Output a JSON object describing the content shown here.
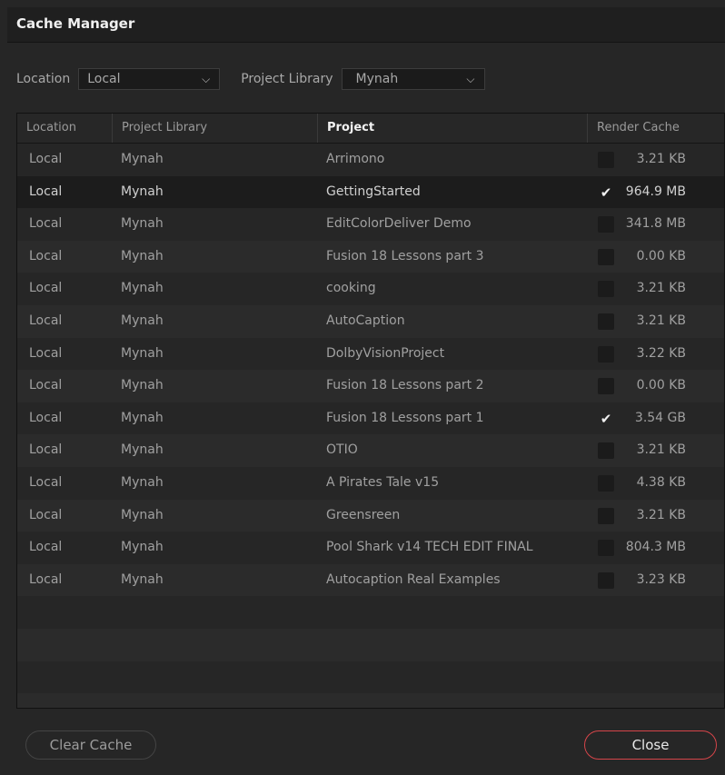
{
  "window": {
    "title": "Cache Manager"
  },
  "filters": {
    "location_label": "Location",
    "location_value": "Local",
    "library_label": "Project Library",
    "library_value": "Mynah"
  },
  "table": {
    "columns": [
      "Location",
      "Project Library",
      "Project",
      "Render Cache"
    ],
    "active_column": "Project",
    "rows": [
      {
        "location": "Local",
        "library": "Mynah",
        "project": "Arrimono",
        "checked": false,
        "size": "3.21 KB"
      },
      {
        "location": "Local",
        "library": "Mynah",
        "project": "GettingStarted",
        "checked": true,
        "size": "964.9 MB",
        "selected": true
      },
      {
        "location": "Local",
        "library": "Mynah",
        "project": "EditColorDeliver Demo",
        "checked": false,
        "size": "341.8 MB"
      },
      {
        "location": "Local",
        "library": "Mynah",
        "project": "Fusion 18 Lessons part 3",
        "checked": false,
        "size": "0.00 KB"
      },
      {
        "location": "Local",
        "library": "Mynah",
        "project": "cooking",
        "checked": false,
        "size": "3.21 KB"
      },
      {
        "location": "Local",
        "library": "Mynah",
        "project": "AutoCaption",
        "checked": false,
        "size": "3.21 KB"
      },
      {
        "location": "Local",
        "library": "Mynah",
        "project": "DolbyVisionProject",
        "checked": false,
        "size": "3.22 KB"
      },
      {
        "location": "Local",
        "library": "Mynah",
        "project": "Fusion 18 Lessons part 2",
        "checked": false,
        "size": "0.00 KB"
      },
      {
        "location": "Local",
        "library": "Mynah",
        "project": "Fusion 18  Lessons part 1",
        "checked": true,
        "size": "3.54 GB"
      },
      {
        "location": "Local",
        "library": "Mynah",
        "project": "OTIO",
        "checked": false,
        "size": "3.21 KB"
      },
      {
        "location": "Local",
        "library": "Mynah",
        "project": "A Pirates Tale v15",
        "checked": false,
        "size": "4.38 KB"
      },
      {
        "location": "Local",
        "library": "Mynah",
        "project": "Greensreen",
        "checked": false,
        "size": "3.21 KB"
      },
      {
        "location": "Local",
        "library": "Mynah",
        "project": "Pool Shark v14 TECH EDIT FINAL",
        "checked": false,
        "size": "804.3 MB"
      },
      {
        "location": "Local",
        "library": "Mynah",
        "project": "Autocaption Real Examples",
        "checked": false,
        "size": "3.23 KB"
      }
    ],
    "empty_rows": 4
  },
  "footer": {
    "clear_label": "Clear Cache",
    "close_label": "Close"
  },
  "icons": {
    "dropdown": "chevron-down-icon",
    "check": "checkmark-icon"
  },
  "colors": {
    "close_border": "#d6454a",
    "background": "#262626"
  }
}
